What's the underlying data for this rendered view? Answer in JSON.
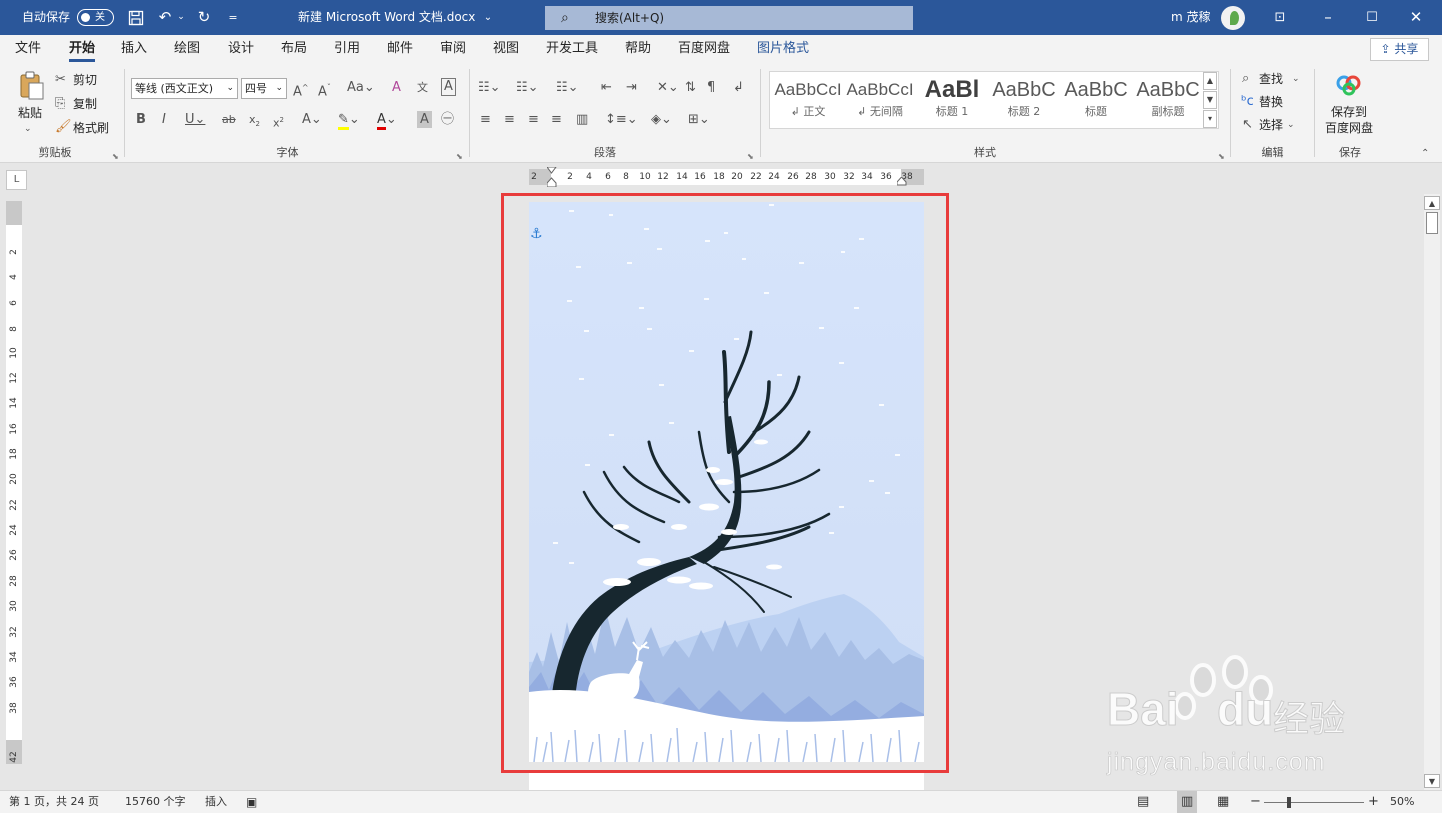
{
  "titlebar": {
    "autosave_label": "自动保存",
    "autosave_state": "关",
    "doc_title": "新建 Microsoft Word 文档.docx",
    "search_placeholder": "搜索(Alt+Q)",
    "user_name": "m 茂稼",
    "bg_color": "#2b579a"
  },
  "tabs": [
    "文件",
    "开始",
    "插入",
    "绘图",
    "设计",
    "布局",
    "引用",
    "邮件",
    "审阅",
    "视图",
    "开发工具",
    "帮助",
    "百度网盘",
    "图片格式"
  ],
  "active_tab": "开始",
  "share_label": "共享",
  "ribbon": {
    "clipboard": {
      "paste": "粘贴",
      "cut": "剪切",
      "copy": "复制",
      "format_painter": "格式刷",
      "label": "剪贴板"
    },
    "font": {
      "font_name": "等线 (西文正文)",
      "font_size": "四号",
      "label": "字体",
      "aa_label": "Aa",
      "wen_label": "文",
      "a_label": "A"
    },
    "paragraph": {
      "label": "段落"
    },
    "styles": {
      "label": "样式",
      "items": [
        {
          "preview": "AaBbCcI",
          "name": "正文",
          "prefix": "↲ "
        },
        {
          "preview": "AaBbCcI",
          "name": "无间隔",
          "prefix": "↲ "
        },
        {
          "preview": "AaBl",
          "name": "标题 1",
          "prefix": ""
        },
        {
          "preview": "AaBbC",
          "name": "标题 2",
          "prefix": ""
        },
        {
          "preview": "AaBbC",
          "name": "标题",
          "prefix": ""
        },
        {
          "preview": "AaBbC",
          "name": "副标题",
          "prefix": ""
        }
      ]
    },
    "editing": {
      "find": "查找",
      "replace": "替换",
      "select": "选择",
      "label": "编辑"
    },
    "save": {
      "line1": "保存到",
      "line2": "百度网盘",
      "label": "保存"
    }
  },
  "ruler": {
    "h_numbers": [
      "2",
      "2",
      "4",
      "6",
      "8",
      "10",
      "12",
      "14",
      "16",
      "18",
      "20",
      "22",
      "24",
      "26",
      "28",
      "30",
      "32",
      "34",
      "36",
      "38"
    ],
    "v_numbers": [
      "2",
      "4",
      "6",
      "8",
      "10",
      "12",
      "14",
      "16",
      "18",
      "20",
      "22",
      "24",
      "26",
      "28",
      "30",
      "32",
      "34",
      "36",
      "38",
      "42"
    ],
    "corner": "L"
  },
  "status": {
    "page": "第 1 页，共 24 页",
    "words": "15760 个字",
    "mode": "插入",
    "zoom": "50%",
    "zoom_minus": "−",
    "zoom_plus": "+"
  },
  "watermark": {
    "brand": "Bai",
    "brand2": "du",
    "cn": "经验",
    "url": "jingyan.baidu.com"
  },
  "colors": {
    "accent": "#2b579a",
    "highlight": "#e83c3c",
    "sky": "#d8e5fa",
    "tree": "#17272f"
  }
}
